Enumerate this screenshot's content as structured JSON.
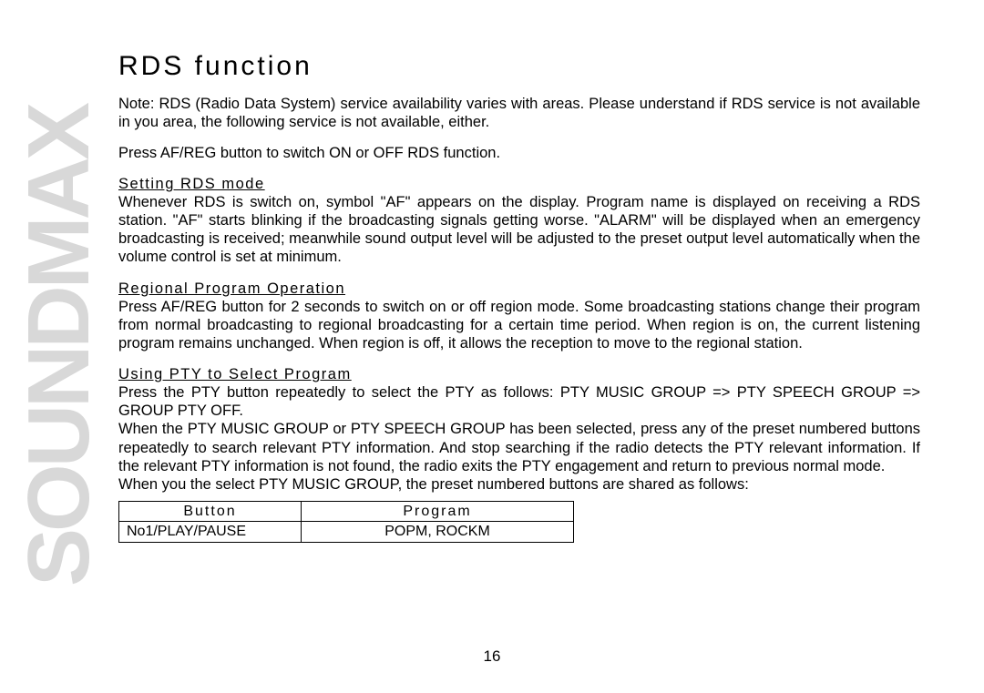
{
  "watermark": "SOUNDMAX",
  "title": "RDS function",
  "note": "Note: RDS (Radio Data System) service availability varies with areas. Please understand if RDS service is not available in you area, the following service is not available, either.",
  "press_af": "Press AF/REG button to switch ON or OFF RDS function.",
  "sec1_head": "Setting RDS mode",
  "sec1_body": "Whenever RDS is switch on, symbol \"AF\" appears on the display. Program name is displayed on receiving a RDS station. \"AF\" starts blinking if the broadcasting signals getting worse. \"ALARM\" will be displayed when an emergency broadcasting is received; meanwhile sound output level will be adjusted to the preset output level automatically when the volume control is set at minimum.",
  "sec2_head": "Regional Program Operation",
  "sec2_body": "Press AF/REG button for 2 seconds to switch on or off region mode. Some broadcasting stations change their program from normal broadcasting to regional broadcasting for a certain time period. When region is on, the current listening program remains unchanged. When region is off, it allows the reception to move to the regional station.",
  "sec3_head": "Using PTY to Select Program",
  "sec3_p1": "Press the PTY button repeatedly to select the PTY as follows: PTY MUSIC GROUP => PTY SPEECH GROUP => GROUP PTY OFF.",
  "sec3_p2": "When the PTY MUSIC GROUP or PTY SPEECH GROUP has been selected, press any of the preset numbered buttons repeatedly to search relevant PTY information. And stop searching if the radio detects the PTY relevant information. If the relevant PTY information is not found, the radio exits the PTY engagement and return to previous normal mode.",
  "sec3_p3": "When you the select PTY MUSIC GROUP, the preset numbered buttons are shared as follows:",
  "table": {
    "head_button": "Button",
    "head_program": "Program",
    "row1_button": "No1/PLAY/PAUSE",
    "row1_program": "POPM, ROCKM"
  },
  "page_number": "16"
}
